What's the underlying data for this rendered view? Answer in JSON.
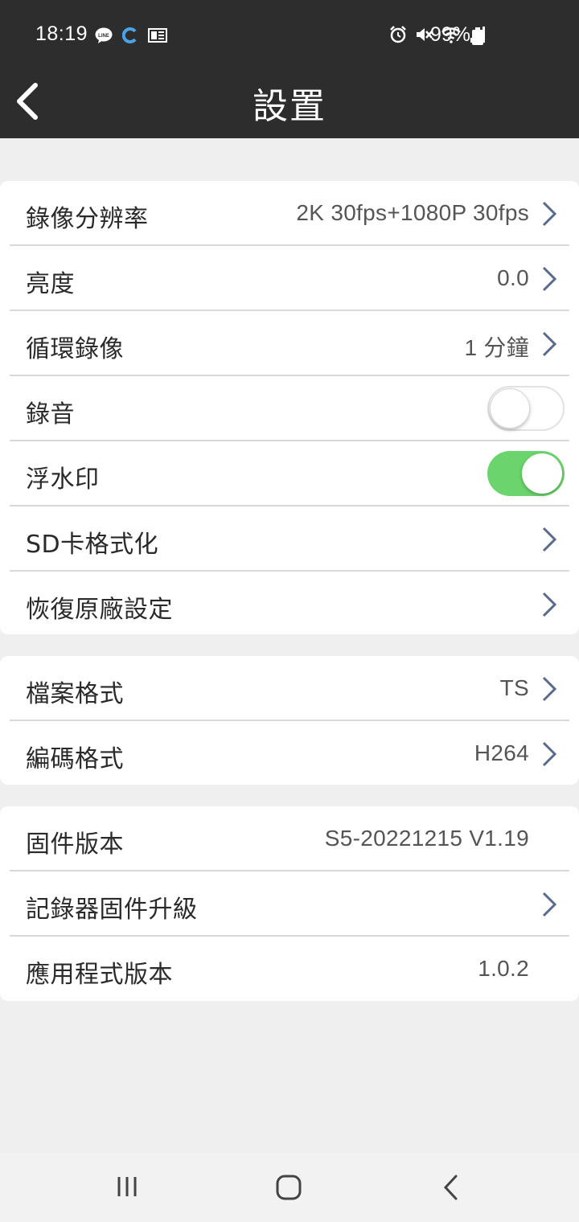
{
  "status_bar": {
    "time": "18:19",
    "battery_percent": "99%",
    "icons": [
      "line-icon",
      "c-app-icon",
      "news-icon",
      "alarm-icon",
      "mute-icon",
      "wifi-icon",
      "signal-icon",
      "battery-icon"
    ]
  },
  "header": {
    "title": "設置",
    "back_icon": "chevron-left-icon"
  },
  "groups": [
    {
      "rows": [
        {
          "label": "錄像分辨率",
          "value": "2K 30fps+1080P 30fps",
          "type": "chevron"
        },
        {
          "label": "亮度",
          "value": "0.0",
          "type": "chevron"
        },
        {
          "label": "循環錄像",
          "value": "1 分鐘",
          "type": "chevron"
        },
        {
          "label": "錄音",
          "toggle": false,
          "type": "toggle"
        },
        {
          "label": "浮水印",
          "toggle": true,
          "type": "toggle"
        },
        {
          "label": "SD卡格式化",
          "value": "",
          "type": "chevron"
        },
        {
          "label": "恢復原廠設定",
          "value": "",
          "type": "chevron"
        }
      ]
    },
    {
      "rows": [
        {
          "label": "檔案格式",
          "value": "TS",
          "type": "chevron"
        },
        {
          "label": "編碼格式",
          "value": "H264",
          "type": "chevron"
        }
      ]
    },
    {
      "rows": [
        {
          "label": "固件版本",
          "value": "S5-20221215 V1.19",
          "type": "static"
        },
        {
          "label": "記錄器固件升級",
          "value": "",
          "type": "chevron"
        },
        {
          "label": "應用程式版本",
          "value": "1.0.2",
          "type": "static"
        }
      ]
    }
  ],
  "colors": {
    "header_bg": "#2d2d2d",
    "page_bg": "#efefef",
    "toggle_on": "#6bd46c",
    "chevron": "#5a6a8a"
  },
  "nav_bar": {
    "icons": [
      "recents-icon",
      "home-icon",
      "back-icon"
    ]
  }
}
